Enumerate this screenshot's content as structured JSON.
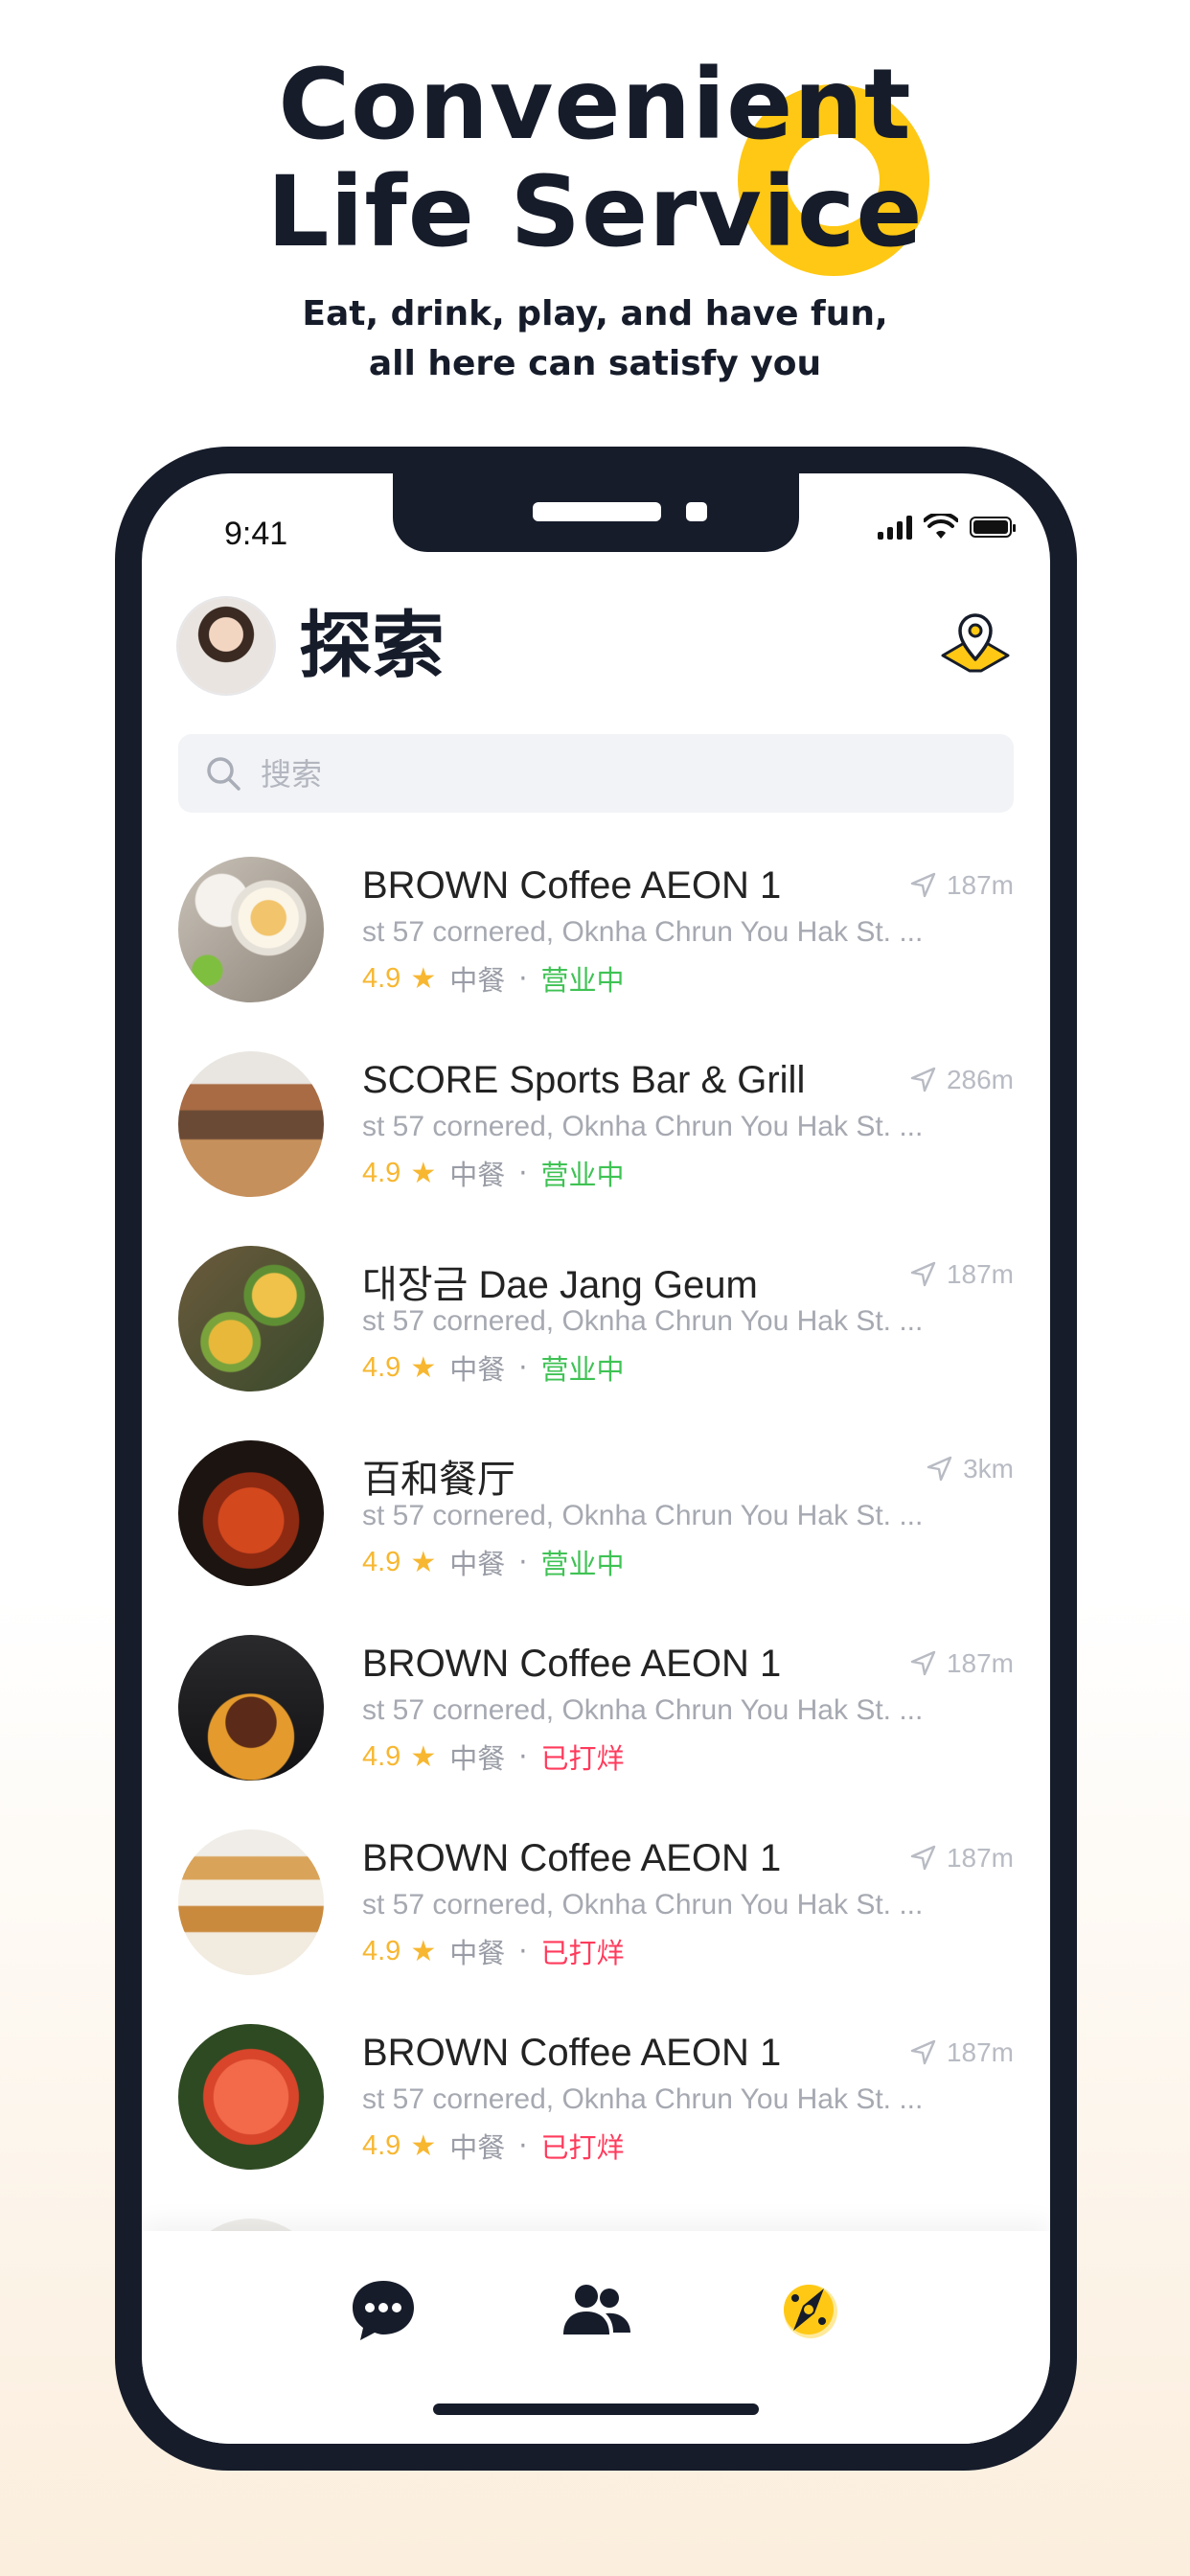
{
  "hero": {
    "title": "Convenient\nLife Service",
    "subtitle": "Eat, drink, play, and have fun,\nall here can satisfy you",
    "accent_color": "#ffc814"
  },
  "status_bar": {
    "time": "9:41",
    "icons": [
      "signal-icon",
      "wifi-icon",
      "battery-icon"
    ]
  },
  "header": {
    "title": "探索",
    "avatar_icon": "avatar",
    "location_icon": "map-pin-icon"
  },
  "search": {
    "placeholder": "搜索",
    "value": "",
    "icon": "search-icon"
  },
  "list": [
    {
      "name": "BROWN Coffee AEON 1",
      "distance": "187m",
      "address": "st 57 cornered, Oknha Chrun You Hak St. ...",
      "rating": "4.9",
      "cuisine": "中餐",
      "status": "营业中",
      "status_type": "open"
    },
    {
      "name": "SCORE Sports Bar & Grill",
      "distance": "286m",
      "address": "st 57 cornered, Oknha Chrun You Hak St. ...",
      "rating": "4.9",
      "cuisine": "中餐",
      "status": "营业中",
      "status_type": "open"
    },
    {
      "name": "대장금 Dae Jang Geum",
      "distance": "187m",
      "address": "st 57 cornered, Oknha Chrun You Hak St. ...",
      "rating": "4.9",
      "cuisine": "中餐",
      "status": "营业中",
      "status_type": "open"
    },
    {
      "name": "百和餐厅",
      "distance": "3km",
      "address": "st 57 cornered, Oknha Chrun You Hak St. ...",
      "rating": "4.9",
      "cuisine": "中餐",
      "status": "营业中",
      "status_type": "open"
    },
    {
      "name": "BROWN Coffee AEON 1",
      "distance": "187m",
      "address": "st 57 cornered, Oknha Chrun You Hak St. ...",
      "rating": "4.9",
      "cuisine": "中餐",
      "status": "已打烊",
      "status_type": "closed"
    },
    {
      "name": "BROWN Coffee AEON 1",
      "distance": "187m",
      "address": "st 57 cornered, Oknha Chrun You Hak St. ...",
      "rating": "4.9",
      "cuisine": "中餐",
      "status": "已打烊",
      "status_type": "closed"
    },
    {
      "name": "BROWN Coffee AEON 1",
      "distance": "187m",
      "address": "st 57 cornered, Oknha Chrun You Hak St. ...",
      "rating": "4.9",
      "cuisine": "中餐",
      "status": "已打烊",
      "status_type": "closed"
    }
  ],
  "separator": "·",
  "star_glyph": "★",
  "tabs": [
    {
      "icon": "chat-bubble-icon",
      "active": false
    },
    {
      "icon": "contacts-icon",
      "active": false
    },
    {
      "icon": "explore-icon",
      "active": true
    }
  ],
  "colors": {
    "dark": "#161c2a",
    "rating": "#f7b731",
    "open": "#3fc254",
    "closed": "#ff3b5c",
    "muted": "#a6a9b1"
  }
}
